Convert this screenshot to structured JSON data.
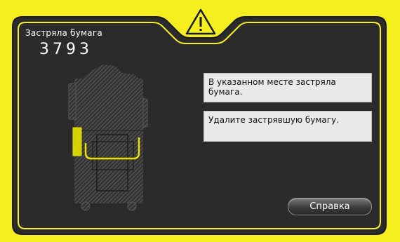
{
  "header": {
    "title": "Застряла бумага",
    "code": "3793",
    "warning_icon": "warning-triangle-icon"
  },
  "messages": [
    "В указанном месте застряла бумага.",
    "Удалите застрявшую бумагу."
  ],
  "help_button": {
    "label": "Справка"
  },
  "colors": {
    "frame_yellow": "#f5ef1f",
    "panel_bg": "#2b2b2b",
    "highlight": "#e8e000",
    "message_bg": "#e9e9e9"
  }
}
